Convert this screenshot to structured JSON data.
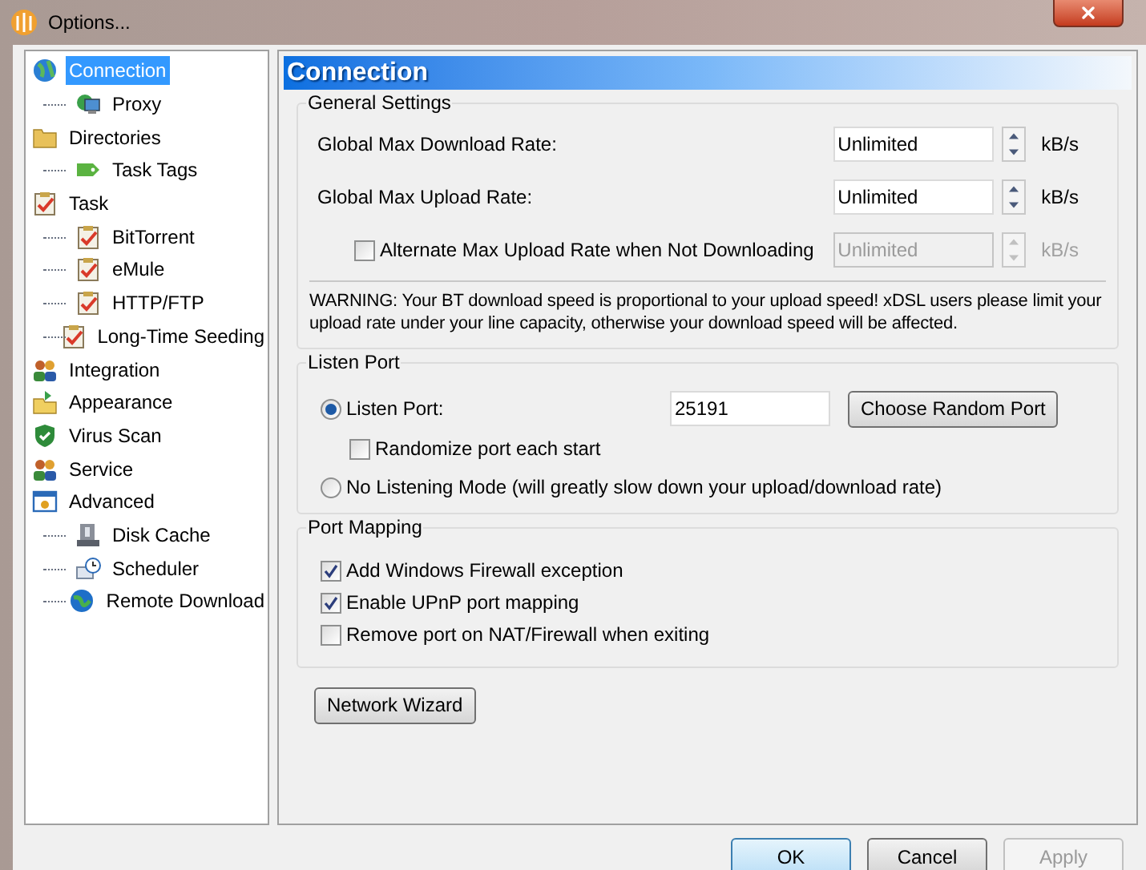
{
  "window": {
    "title": "Options..."
  },
  "sidebar": {
    "items": [
      {
        "label": "Connection",
        "selected": true,
        "children": [
          {
            "label": "Proxy",
            "selected": false
          }
        ]
      },
      {
        "label": "Directories",
        "selected": false,
        "children": [
          {
            "label": "Task Tags",
            "selected": false
          }
        ]
      },
      {
        "label": "Task",
        "selected": false,
        "children": [
          {
            "label": "BitTorrent",
            "selected": false
          },
          {
            "label": "eMule",
            "selected": false
          },
          {
            "label": "HTTP/FTP",
            "selected": false
          },
          {
            "label": "Long-Time Seeding",
            "selected": false
          }
        ]
      },
      {
        "label": "Integration",
        "selected": false
      },
      {
        "label": "Appearance",
        "selected": false
      },
      {
        "label": "Virus Scan",
        "selected": false
      },
      {
        "label": "Service",
        "selected": false
      },
      {
        "label": "Advanced",
        "selected": false,
        "children": [
          {
            "label": "Disk Cache",
            "selected": false
          },
          {
            "label": "Scheduler",
            "selected": false
          },
          {
            "label": "Remote Download",
            "selected": false
          }
        ]
      }
    ]
  },
  "panel": {
    "title": "Connection",
    "general_settings": {
      "title": "General Settings",
      "rates": [
        {
          "kind": "plain",
          "label": "Global Max Download Rate:",
          "value": "Unlimited",
          "unit": "kB/s",
          "disabled": false
        },
        {
          "kind": "plain",
          "label": "Global Max Upload Rate:",
          "value": "Unlimited",
          "unit": "kB/s",
          "disabled": false
        },
        {
          "kind": "checkbox",
          "label": "Alternate Max Upload Rate when Not Downloading",
          "checked": false,
          "value": "Unlimited",
          "unit": "kB/s",
          "disabled": true
        }
      ],
      "warning": "WARNING: Your BT download speed is proportional to your upload speed! xDSL users please limit your upload rate under your line capacity, otherwise your download speed will be affected."
    },
    "listen_port": {
      "title": "Listen Port",
      "listen": {
        "label": "Listen Port:",
        "selected": true
      },
      "port": "25191",
      "random_button": "Choose Random Port",
      "randomize": {
        "label": "Randomize port each start",
        "checked": false
      },
      "no_listen": {
        "label": "No Listening Mode (will greatly slow down your upload/download rate)",
        "selected": false
      }
    },
    "port_mapping": {
      "title": "Port Mapping",
      "options": [
        {
          "label": "Add Windows Firewall exception",
          "checked": true
        },
        {
          "label": "Enable UPnP port mapping",
          "checked": true
        },
        {
          "label": "Remove port on NAT/Firewall when exiting",
          "checked": false
        }
      ]
    },
    "wizard_button": "Network Wizard"
  },
  "buttons": [
    {
      "label": "OK",
      "kind": "default",
      "disabled": false
    },
    {
      "label": "Cancel",
      "kind": "normal",
      "disabled": false
    },
    {
      "label": "Apply",
      "kind": "normal",
      "disabled": true
    }
  ]
}
